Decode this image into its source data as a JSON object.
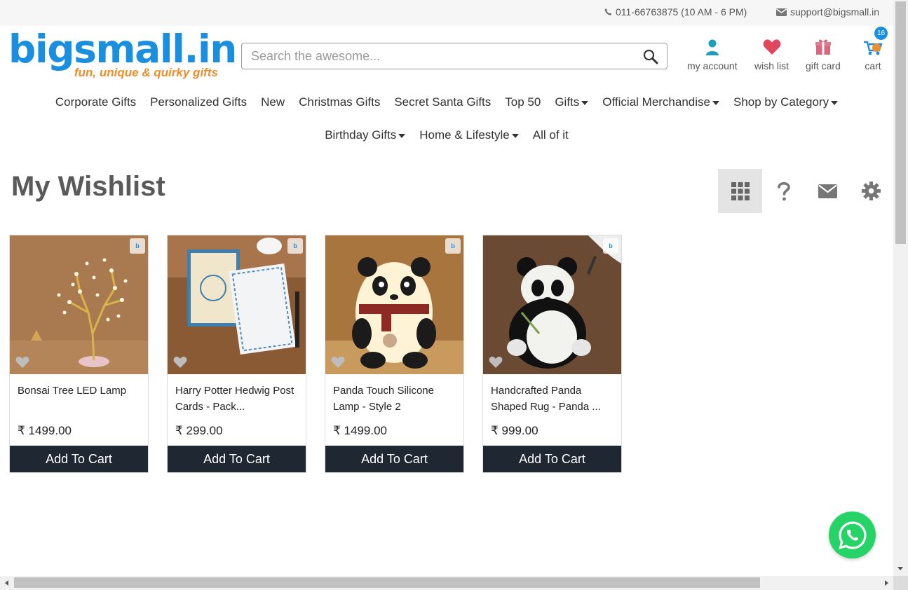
{
  "topbar": {
    "phone": "011-66763875 (10 AM - 6 PM)",
    "email": "support@bigsmall.in"
  },
  "logo": {
    "brand": "bigsmall.in",
    "tagline": "fun, unique & quirky gifts"
  },
  "search": {
    "placeholder": "Search the awesome..."
  },
  "header_icons": {
    "account_label": "my account",
    "wishlist_label": "wish list",
    "giftcard_label": "gift card",
    "cart_label": "cart",
    "cart_count": "16"
  },
  "nav": {
    "row1": [
      {
        "label": "Corporate Gifts",
        "dropdown": false
      },
      {
        "label": "Personalized Gifts",
        "dropdown": false
      },
      {
        "label": "New",
        "dropdown": false
      },
      {
        "label": "Christmas Gifts",
        "dropdown": false
      },
      {
        "label": "Secret Santa Gifts",
        "dropdown": false
      },
      {
        "label": "Top 50",
        "dropdown": false
      },
      {
        "label": "Gifts",
        "dropdown": true
      },
      {
        "label": "Official Merchandise",
        "dropdown": true
      },
      {
        "label": "Shop by Category",
        "dropdown": true
      }
    ],
    "row2": [
      {
        "label": "Birthday Gifts",
        "dropdown": true
      },
      {
        "label": "Home & Lifestyle",
        "dropdown": true
      },
      {
        "label": "All of it",
        "dropdown": false
      }
    ]
  },
  "page_title": "My Wishlist",
  "tools": {
    "icons": [
      "grid-icon",
      "help-icon",
      "mail-icon",
      "settings-icon"
    ]
  },
  "products": [
    {
      "name": "Bonsai Tree LED Lamp",
      "price": "₹ 1499.00",
      "button": "Add To Cart"
    },
    {
      "name": "Harry Potter Hedwig Post Cards - Pack...",
      "price": "₹ 299.00",
      "button": "Add To Cart"
    },
    {
      "name": "Panda Touch Silicone Lamp - Style 2",
      "price": "₹ 1499.00",
      "button": "Add To Cart"
    },
    {
      "name": "Handcrafted Panda Shaped Rug - Panda ...",
      "price": "₹ 999.00",
      "button": "Add To Cart"
    }
  ],
  "colors": {
    "brand_blue": "#1a8fe0",
    "brand_orange": "#ee8d2a",
    "button_dark": "#1f2733",
    "whatsapp_green": "#25d366"
  }
}
